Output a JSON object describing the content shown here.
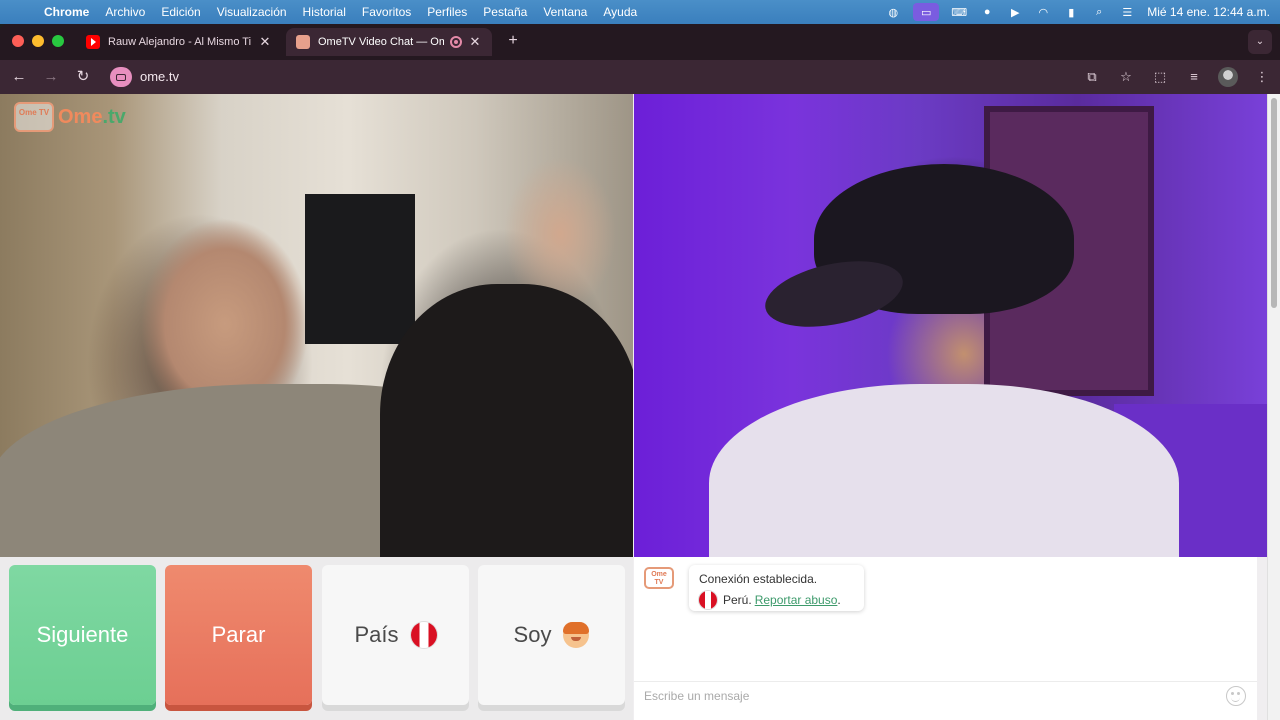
{
  "menubar": {
    "app_name": "Chrome",
    "items": [
      "Archivo",
      "Edición",
      "Visualización",
      "Historial",
      "Favoritos",
      "Perfiles",
      "Pestaña",
      "Ventana",
      "Ayuda"
    ],
    "clock": "Mié 14 ene.  12:44 a.m."
  },
  "tabs": [
    {
      "title": "Rauw Alejandro - Al Mismo Ti",
      "icon": "youtube-icon",
      "active": false
    },
    {
      "title": "OmeTV Video Chat — Ome",
      "icon": "ometv-icon",
      "active": true
    }
  ],
  "address_bar": {
    "url": "ome.tv"
  },
  "site": {
    "logo_text": "Ome",
    "logo_suffix": ".tv",
    "logo_badge": "Ome TV"
  },
  "controls": {
    "next_label": "Siguiente",
    "stop_label": "Parar",
    "country_label": "País",
    "country_flag": "peru-flag-icon",
    "gender_label": "Soy",
    "gender_icon": "boy-emoji-icon"
  },
  "chat": {
    "status_message": "Conexión establecida.",
    "country_name": "Perú.",
    "report_link": "Reportar abuso",
    "report_suffix": ".",
    "input_placeholder": "Escribe un mensaje"
  },
  "colors": {
    "next_button": "#6ccf92",
    "stop_button": "#e6705a",
    "link": "#3d9a6b",
    "tab_bar": "#241820",
    "toolbar": "#3b2734"
  }
}
